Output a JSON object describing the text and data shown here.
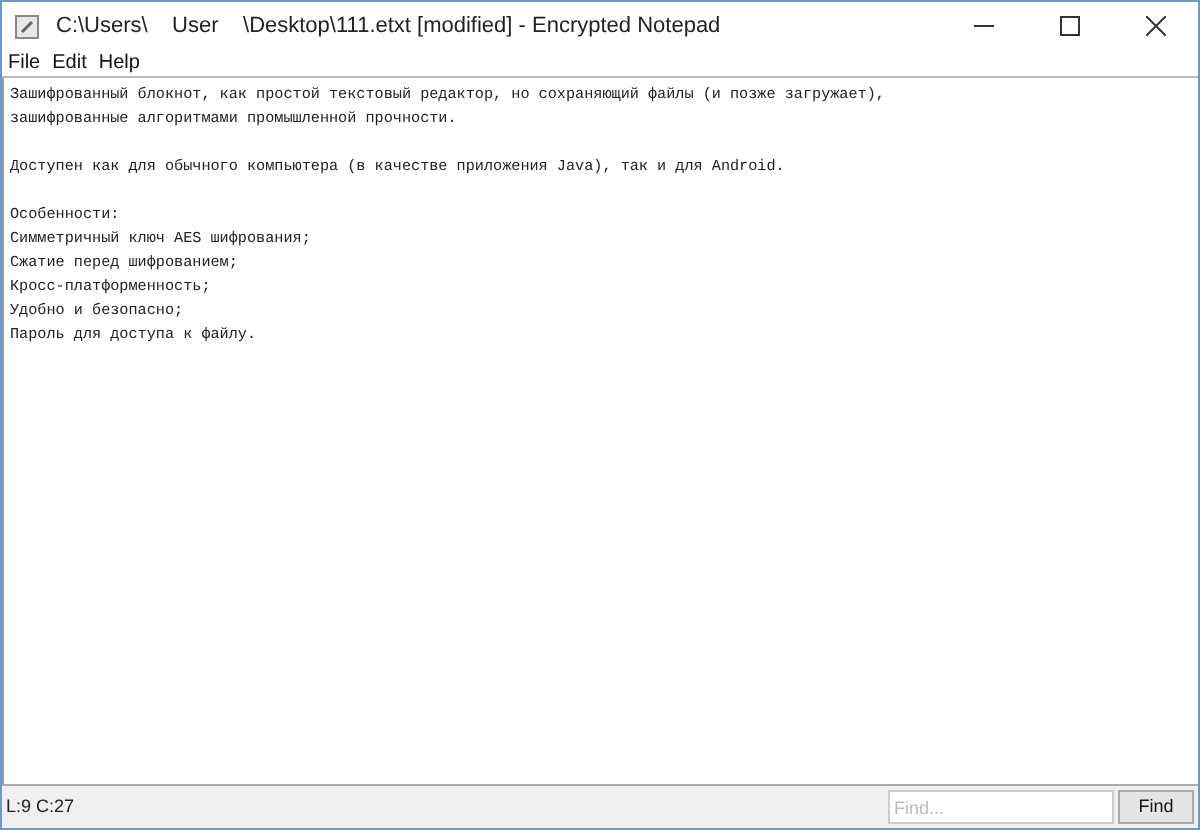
{
  "window": {
    "title": "C:\\Users\\    User    \\Desktop\\111.etxt [modified] - Encrypted Notepad"
  },
  "menu": [
    {
      "label": "File"
    },
    {
      "label": "Edit"
    },
    {
      "label": "Help"
    }
  ],
  "document": {
    "paragraphs": [
      [
        "Зашифрованный блокнот, как простой текстовый редактор, но сохраняющий файлы (и позже загружает),",
        "зашифрованные алгоритмами промышленной прочности."
      ],
      [
        "Доступен как для обычного компьютера (в качестве приложения Java), так и для Android."
      ],
      [
        "Особенности:",
        "Симметричный ключ AES шифрования;",
        "Сжатие перед шифрованием;",
        "Кросс-платформенность;",
        "Удобно и безопасно;",
        "Пароль для доступа к файлу."
      ]
    ]
  },
  "status_bar": {
    "position": "L:9 C:27",
    "find": {
      "placeholder": "Find..."
    },
    "find_button": "Find"
  }
}
